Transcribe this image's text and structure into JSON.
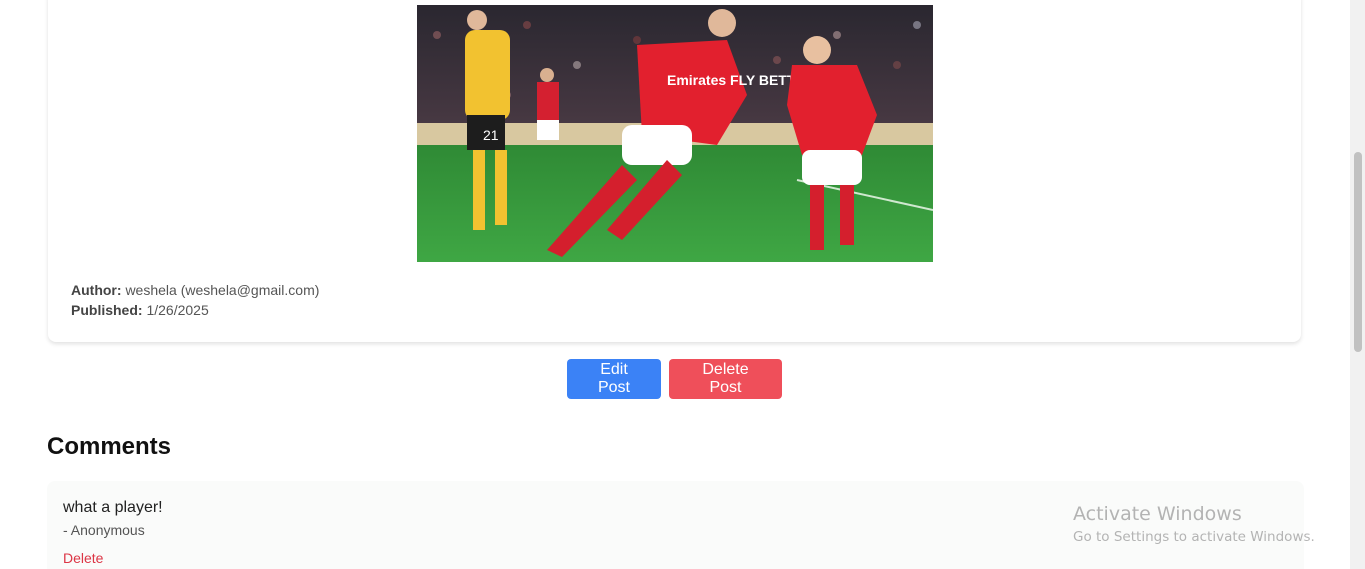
{
  "post": {
    "image_alt": "Arsenal players celebrating a goal",
    "image_sponsor_text": "Emirates FLY BETTER",
    "author_label": "Author:",
    "author_value": "weshela (weshela@gmail.com)",
    "published_label": "Published:",
    "published_value": "1/26/2025"
  },
  "actions": {
    "edit_label": "Edit Post",
    "delete_label": "Delete Post"
  },
  "comments": {
    "title": "Comments",
    "items": [
      {
        "text": "what a player!",
        "author": "- Anonymous",
        "delete_label": "Delete"
      }
    ]
  },
  "watermark": {
    "title": "Activate Windows",
    "subtitle": "Go to Settings to activate Windows."
  },
  "colors": {
    "edit_button": "#3b82f6",
    "delete_button": "#ef4f5a",
    "delete_link": "#dc3545"
  }
}
